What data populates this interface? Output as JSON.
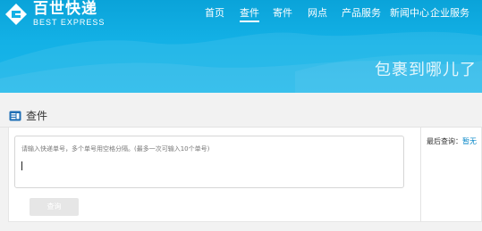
{
  "header": {
    "logo_cn": "百世快递",
    "logo_en": "BEST EXPRESS",
    "nav": [
      {
        "label": "首页"
      },
      {
        "label": "查件"
      },
      {
        "label": "寄件"
      },
      {
        "label": "网点"
      },
      {
        "label": "产品服务"
      },
      {
        "label": "新闻中心"
      },
      {
        "label": "企业服务"
      }
    ],
    "active_nav": "查件",
    "slogan": "包裹到哪儿了"
  },
  "section": {
    "title": "查件"
  },
  "query": {
    "placeholder": "请输入快递单号，多个单号用空格分隔。(最多一次可输入10个单号)",
    "value": "",
    "submit_label": "查询"
  },
  "sidebar": {
    "last_query_label": "最后查询：",
    "last_query_value": "暂无"
  },
  "colors": {
    "brand_blue": "#13b1e6",
    "link_blue": "#0a88c8"
  }
}
